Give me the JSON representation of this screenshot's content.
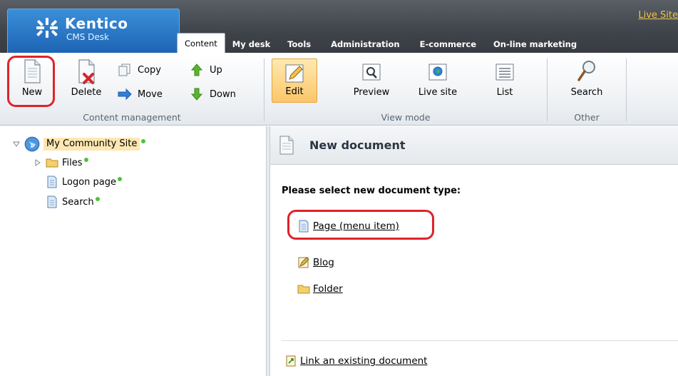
{
  "header": {
    "logo_title": "Kentico",
    "logo_subtitle": "CMS Desk",
    "live_site_link": "Live Site",
    "tabs": [
      {
        "label": "Content",
        "active": true
      },
      {
        "label": "My desk"
      },
      {
        "label": "Tools"
      },
      {
        "label": "Administration"
      },
      {
        "label": "E-commerce"
      },
      {
        "label": "On-line marketing"
      }
    ]
  },
  "toolbar": {
    "content_management": {
      "label": "Content management",
      "new": "New",
      "delete": "Delete",
      "copy": "Copy",
      "move": "Move",
      "up": "Up",
      "down": "Down"
    },
    "view_mode": {
      "label": "View mode",
      "edit": "Edit",
      "preview": "Preview",
      "live_site": "Live site",
      "list": "List",
      "selected": "Edit"
    },
    "other": {
      "label": "Other",
      "search": "Search"
    }
  },
  "tree": {
    "root": "My Community Site",
    "items": [
      {
        "label": "Files",
        "icon": "folder-icon"
      },
      {
        "label": "Logon page",
        "icon": "page-icon"
      },
      {
        "label": "Search",
        "icon": "page-icon"
      }
    ]
  },
  "content": {
    "title": "New document",
    "select_label": "Please select new document type:",
    "doc_types": [
      {
        "label": "Page (menu item)",
        "icon": "page-icon"
      },
      {
        "label": "Blog",
        "icon": "blog-icon"
      },
      {
        "label": "Folder",
        "icon": "folder-icon"
      }
    ],
    "link_existing": "Link an existing document"
  },
  "colors": {
    "header_bg": "#3f444a",
    "logo_blue": "#1e64b4",
    "live_site_link": "#f4c542",
    "selected_button": "#fcc66a",
    "status_dot": "#4dc23a",
    "highlight_ring": "#e0222a"
  }
}
